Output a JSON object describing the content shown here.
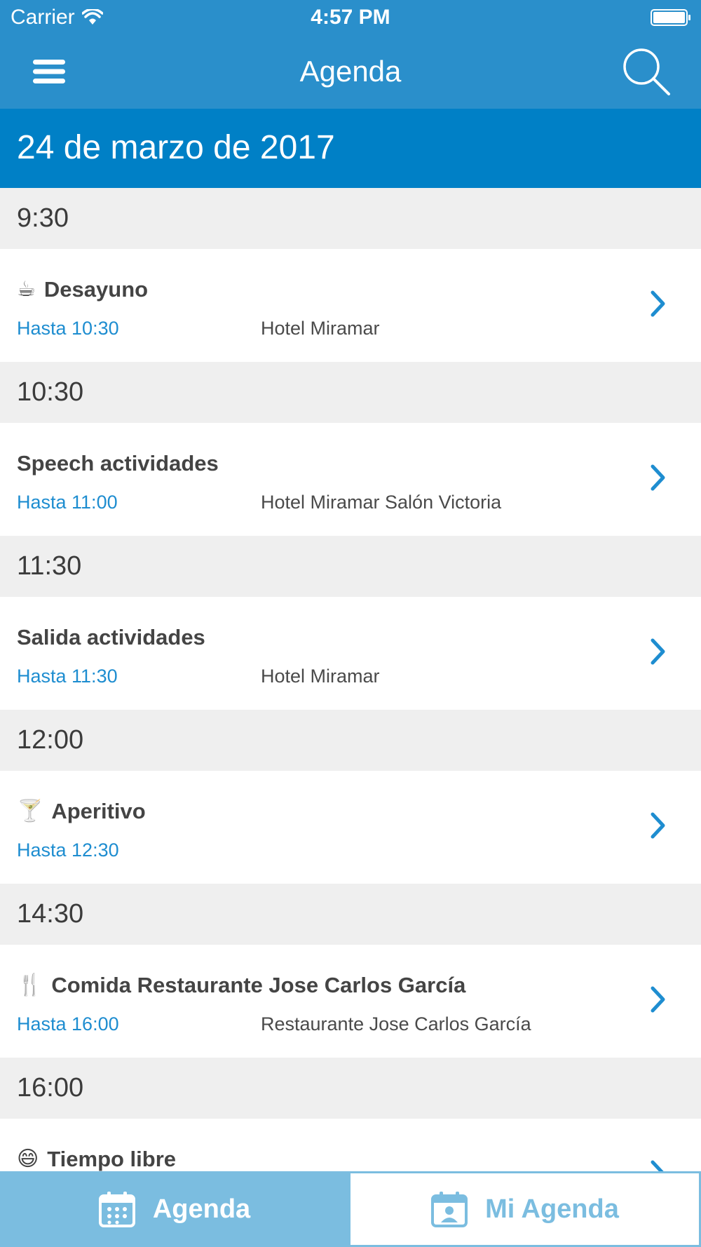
{
  "status_bar": {
    "carrier": "Carrier",
    "time": "4:57 PM"
  },
  "nav": {
    "title": "Agenda",
    "menu_icon": "hamburger-menu-icon",
    "search_icon": "search-icon"
  },
  "date_header": "24 de marzo de 2017",
  "sections": [
    {
      "time": "9:30",
      "event": {
        "emoji": "☕",
        "title": "Desayuno",
        "until": "Hasta 10:30",
        "place": "Hotel Miramar"
      }
    },
    {
      "time": "10:30",
      "event": {
        "emoji": "",
        "title": "Speech actividades",
        "until": "Hasta 11:00",
        "place": "Hotel Miramar Salón Victoria"
      }
    },
    {
      "time": "11:30",
      "event": {
        "emoji": "",
        "title": "Salida actividades",
        "until": "Hasta 11:30",
        "place": "Hotel Miramar"
      }
    },
    {
      "time": "12:00",
      "event": {
        "emoji": "🍸",
        "title": "Aperitivo",
        "until": "Hasta 12:30",
        "place": ""
      }
    },
    {
      "time": "14:30",
      "event": {
        "emoji": "🍴",
        "title": "Comida Restaurante Jose Carlos García",
        "until": "Hasta 16:00",
        "place": "Restaurante Jose Carlos García"
      }
    },
    {
      "time": "16:00",
      "event": {
        "emoji": "😄",
        "title": "Tiempo libre",
        "until": "",
        "place": ""
      }
    }
  ],
  "tabs": [
    {
      "label": "Agenda",
      "icon": "calendar-icon",
      "selected": true
    },
    {
      "label": "Mi Agenda",
      "icon": "calendar-person-icon",
      "selected": false
    }
  ],
  "colors": {
    "nav_bar": "#2a8fcb",
    "date_header": "#0080c6",
    "accent": "#1e8dd0",
    "tab_bar": "#7bbde0"
  }
}
